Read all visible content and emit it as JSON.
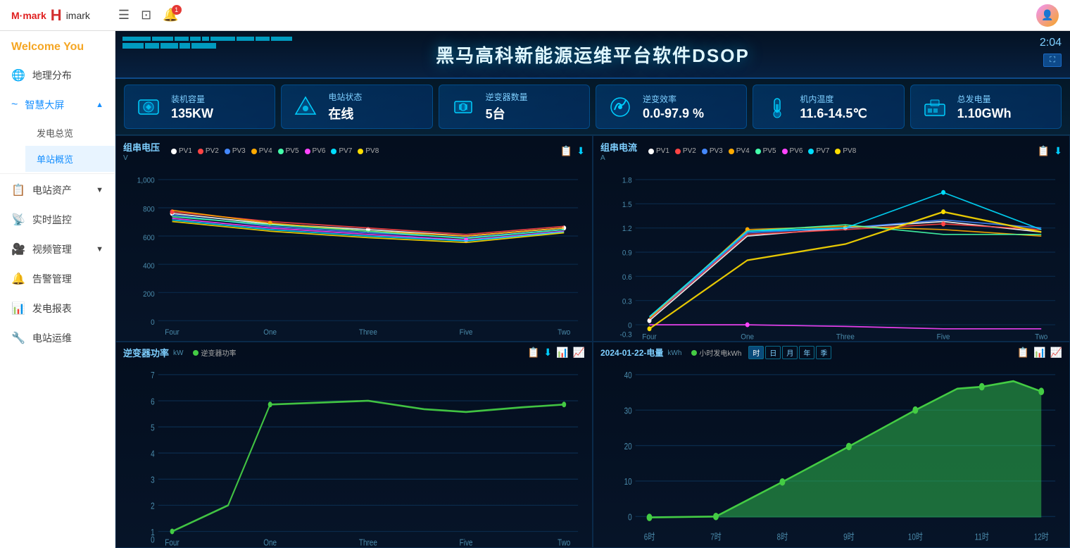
{
  "topbar": {
    "logo_m": "M·mark",
    "logo_h": "H",
    "logo_imark": "imark",
    "time": "2:04"
  },
  "sidebar": {
    "welcome": "Welcome You",
    "items": [
      {
        "id": "geo",
        "label": "地理分布",
        "icon": "🌐",
        "active": false
      },
      {
        "id": "smart-screen",
        "label": "智慧大屏",
        "icon": "🖥",
        "active": true,
        "expanded": true
      },
      {
        "id": "power-overview",
        "label": "发电总览",
        "icon": "",
        "sub": true,
        "active": false
      },
      {
        "id": "station-overview",
        "label": "单站概览",
        "icon": "",
        "sub": true,
        "active": true
      },
      {
        "id": "station-assets",
        "label": "电站资产",
        "icon": "📋",
        "active": false,
        "hasArrow": true
      },
      {
        "id": "realtime-monitor",
        "label": "实时监控",
        "icon": "📡",
        "active": false
      },
      {
        "id": "video-mgmt",
        "label": "视频管理",
        "icon": "🎥",
        "active": false,
        "hasArrow": true
      },
      {
        "id": "alarm-mgmt",
        "label": "告警管理",
        "icon": "🔔",
        "active": false
      },
      {
        "id": "power-report",
        "label": "发电报表",
        "icon": "📊",
        "active": false
      },
      {
        "id": "station-ops",
        "label": "电站运维",
        "icon": "🔧",
        "active": false
      }
    ]
  },
  "screen": {
    "title": "黑马高科新能源运维平台软件DSOP",
    "time": "2:0",
    "stats": [
      {
        "label": "装机容量",
        "value": "135KW",
        "icon": "capacity"
      },
      {
        "label": "电站状态",
        "value": "在线",
        "icon": "status"
      },
      {
        "label": "逆变器数量",
        "value": "5台",
        "icon": "inverter-count"
      },
      {
        "label": "逆变效率",
        "value": "0.0-97.9 %",
        "icon": "efficiency"
      },
      {
        "label": "机内温度",
        "value": "11.6-14.5℃",
        "icon": "temperature"
      },
      {
        "label": "总发电量",
        "value": "1.10GWh",
        "icon": "total-power"
      }
    ]
  },
  "charts": {
    "voltage": {
      "title": "组串电压",
      "unit": "V",
      "legend": [
        "PV1",
        "PV2",
        "PV3",
        "PV4",
        "PV5",
        "PV6",
        "PV7",
        "PV8"
      ],
      "xLabels": [
        "Four",
        "One",
        "Three",
        "Five",
        "Two"
      ],
      "yMax": 1000,
      "yMin": 0
    },
    "current": {
      "title": "组串电流",
      "unit": "A",
      "legend": [
        "PV1",
        "PV2",
        "PV3",
        "PV4",
        "PV5",
        "PV6",
        "PV7",
        "PV8"
      ],
      "xLabels": [
        "Four",
        "One",
        "Three",
        "Five",
        "Two"
      ],
      "yMax": 1.8,
      "yMin": -0.3
    },
    "power": {
      "title": "逆变器功率",
      "unit": "kW",
      "legend": [
        "逆变器功率"
      ],
      "xLabels": [
        "Four",
        "One",
        "Three",
        "Five",
        "Two"
      ],
      "yMax": 7,
      "yMin": 0
    },
    "energy": {
      "title": "2024-01-22-电量",
      "unit": "kWh",
      "legend": [
        "小时发电kWh"
      ],
      "xLabels": [
        "6时",
        "7时",
        "8时",
        "9时",
        "10时",
        "11时",
        "12时"
      ],
      "yMax": 40,
      "yMin": 0,
      "timeTabs": [
        "时",
        "日",
        "月",
        "年",
        "季"
      ]
    }
  },
  "legend_colors": {
    "PV1": "#ffffff",
    "PV2": "#ff4444",
    "PV3": "#4488ff",
    "PV4": "#ffaa00",
    "PV5": "#44ffaa",
    "PV6": "#ff44ff",
    "PV7": "#00ddff",
    "PV8": "#ffdd00"
  }
}
